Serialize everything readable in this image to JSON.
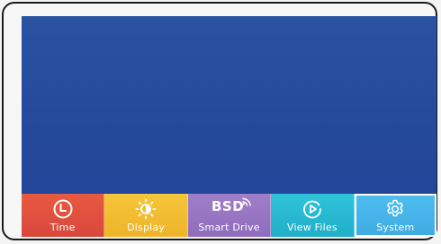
{
  "menu": {
    "selected_index": 4,
    "items": [
      {
        "label": "Time",
        "icon": "clock-icon",
        "color": "#e2523f"
      },
      {
        "label": "Display",
        "icon": "brightness-icon",
        "color": "#f0bf2f"
      },
      {
        "label": "Smart Drive",
        "icon": "bsd-icon",
        "icon_text": "BSD",
        "color": "#9a76c4"
      },
      {
        "label": "View Files",
        "icon": "play-icon",
        "color": "#27b9d2"
      },
      {
        "label": "System",
        "icon": "gear-icon",
        "color": "#45b3e8"
      }
    ]
  },
  "colors": {
    "screen_background": "#24489a",
    "bezel_border": "#1a1a1a"
  }
}
